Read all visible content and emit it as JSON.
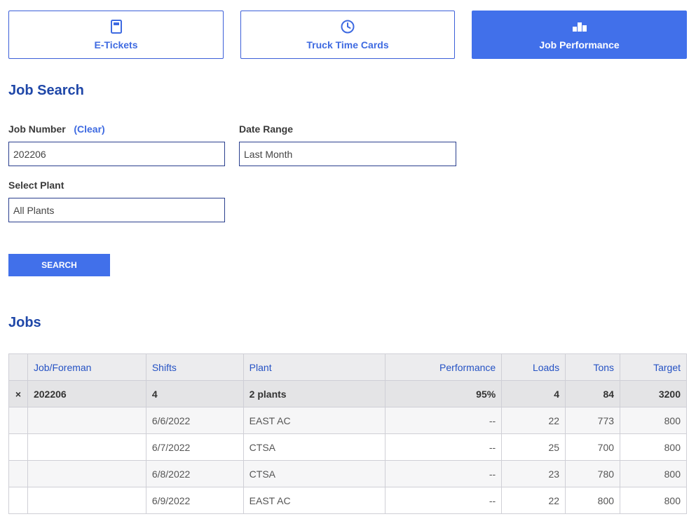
{
  "tabs": [
    {
      "label": "E-Tickets",
      "icon": "ticket-icon",
      "active": false
    },
    {
      "label": "Truck Time Cards",
      "icon": "clock-icon",
      "active": false
    },
    {
      "label": "Job Performance",
      "icon": "chart-icon",
      "active": true
    }
  ],
  "search": {
    "title": "Job Search",
    "job_number_label": "Job Number",
    "clear_label": "(Clear)",
    "job_number_value": "202206",
    "date_range_label": "Date Range",
    "date_range_value": "Last Month",
    "plant_label": "Select Plant",
    "plant_value": "All Plants",
    "button_label": "SEARCH"
  },
  "jobs": {
    "title": "Jobs",
    "columns": [
      "Job/Foreman",
      "Shifts",
      "Plant",
      "Performance",
      "Loads",
      "Tons",
      "Target"
    ],
    "parent": {
      "collapse_icon": "×",
      "job": "202206",
      "shifts": "4",
      "plant": "2 plants",
      "performance": "95%",
      "loads": "4",
      "tons": "84",
      "target": "3200"
    },
    "rows": [
      {
        "shift": "6/6/2022",
        "plant": "EAST AC",
        "performance": "--",
        "loads": "22",
        "tons": "773",
        "target": "800"
      },
      {
        "shift": "6/7/2022",
        "plant": "CTSA",
        "performance": "--",
        "loads": "25",
        "tons": "700",
        "target": "800"
      },
      {
        "shift": "6/8/2022",
        "plant": "CTSA",
        "performance": "--",
        "loads": "23",
        "tons": "780",
        "target": "800"
      },
      {
        "shift": "6/9/2022",
        "plant": "EAST AC",
        "performance": "--",
        "loads": "22",
        "tons": "800",
        "target": "800"
      }
    ]
  },
  "colors": {
    "accent": "#4170ea",
    "heading": "#1f47a8",
    "border": "#2a3f8e"
  }
}
